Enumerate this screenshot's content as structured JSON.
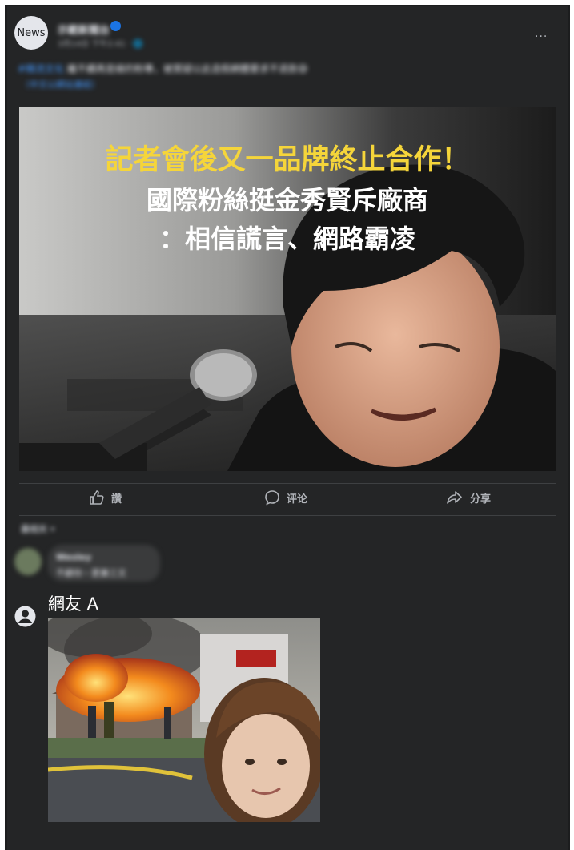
{
  "post": {
    "avatar_label": "News",
    "page_name": "示範新聞台",
    "meta": "3月14日 下午2:41 · 🌐",
    "more": "···",
    "text_tag": "#韓流文化",
    "text_body": " 繼不續再是緣的粉專，被質疑以此造假網體要求不退款",
    "text_emoji": "😅",
    "link": "（中文以網站連結）"
  },
  "headline": {
    "line1": "記者會後又一品牌終止合作！",
    "line2": "國際粉絲挺金秀賢斥廠商",
    "line3": "：相信謊言、網路霸凌"
  },
  "actions": {
    "like": "讚",
    "comment": "评论",
    "share": "分享"
  },
  "comments": {
    "sort_label": "最相关 ▾",
    "first_name": "Wesley",
    "first_text": "不顧你・更兼三文"
  },
  "reply": {
    "author": "網友 A"
  },
  "colors": {
    "panel": "#242526",
    "headline_yellow": "#f5d53a",
    "headline_white": "#ffffff",
    "link_blue": "#4599ff"
  }
}
